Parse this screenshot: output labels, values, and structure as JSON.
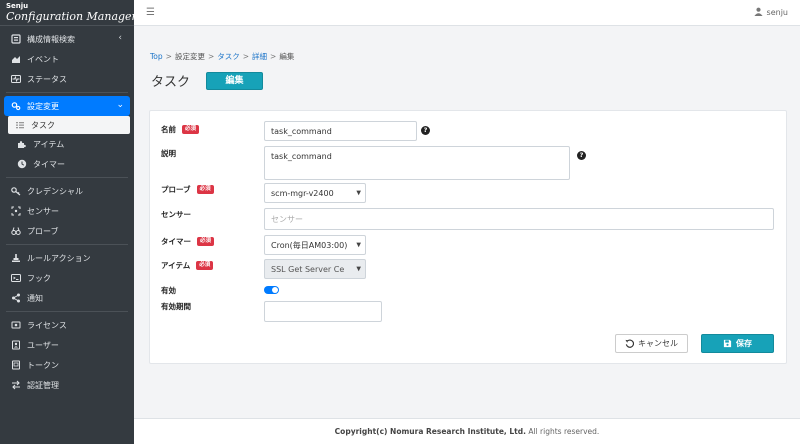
{
  "brand": {
    "small": "Senju",
    "big": "Configuration Manager"
  },
  "sidebar": {
    "groups": [
      [
        {
          "label": "構成情報検索",
          "icon": "database-icon"
        },
        {
          "label": "イベント",
          "icon": "chart-area-icon"
        },
        {
          "label": "ステータス",
          "icon": "heartbeat-icon"
        }
      ],
      [
        {
          "label": "設定変更",
          "icon": "cogs-icon"
        },
        {
          "label": "タスク",
          "icon": "tasks-icon"
        },
        {
          "label": "アイテム",
          "icon": "puzzle-icon"
        },
        {
          "label": "タイマー",
          "icon": "clock-icon"
        }
      ],
      [
        {
          "label": "クレデンシャル",
          "icon": "key-icon"
        },
        {
          "label": "センサー",
          "icon": "crosshair-icon"
        },
        {
          "label": "プローブ",
          "icon": "binoculars-icon"
        }
      ],
      [
        {
          "label": "ルールアクション",
          "icon": "gavel-icon"
        },
        {
          "label": "フック",
          "icon": "hook-icon"
        },
        {
          "label": "通知",
          "icon": "share-icon"
        }
      ],
      [
        {
          "label": "ライセンス",
          "icon": "certificate-icon"
        },
        {
          "label": "ユーザー",
          "icon": "address-book-icon"
        },
        {
          "label": "トークン",
          "icon": "token-icon"
        },
        {
          "label": "認証管理",
          "icon": "exchange-icon"
        }
      ]
    ]
  },
  "topbar": {
    "username": "senju"
  },
  "breadcrumb": {
    "top": "Top",
    "settings": "設定変更",
    "task": "タスク",
    "detail": "詳細",
    "edit": "編集",
    "sep": ">"
  },
  "page": {
    "title": "タスク",
    "mode_badge": "編集"
  },
  "form": {
    "required_label": "必須",
    "name": {
      "label": "名前",
      "value": "task_command"
    },
    "description": {
      "label": "説明",
      "value": "task_command"
    },
    "probe": {
      "label": "プローブ",
      "value": "scm-mgr-v2400"
    },
    "sensor": {
      "label": "センサー",
      "placeholder": "センサー"
    },
    "timer": {
      "label": "タイマー",
      "value": "Cron(毎日AM03:00)"
    },
    "item": {
      "label": "アイテム",
      "value": "SSL Get Server Ce"
    },
    "enabled": {
      "label": "有効",
      "value": true
    },
    "validity": {
      "label": "有効期間",
      "value": ""
    },
    "help_glyph": "?"
  },
  "buttons": {
    "cancel": "キャンセル",
    "save": "保存"
  },
  "footer": {
    "copyright": "Copyright(c) Nomura Research Institute, Ltd.",
    "rights": " All rights reserved."
  },
  "colors": {
    "sidebar": "#343a40",
    "accent": "#007bff",
    "teal": "#17a2b8",
    "required": "#dc3545"
  }
}
